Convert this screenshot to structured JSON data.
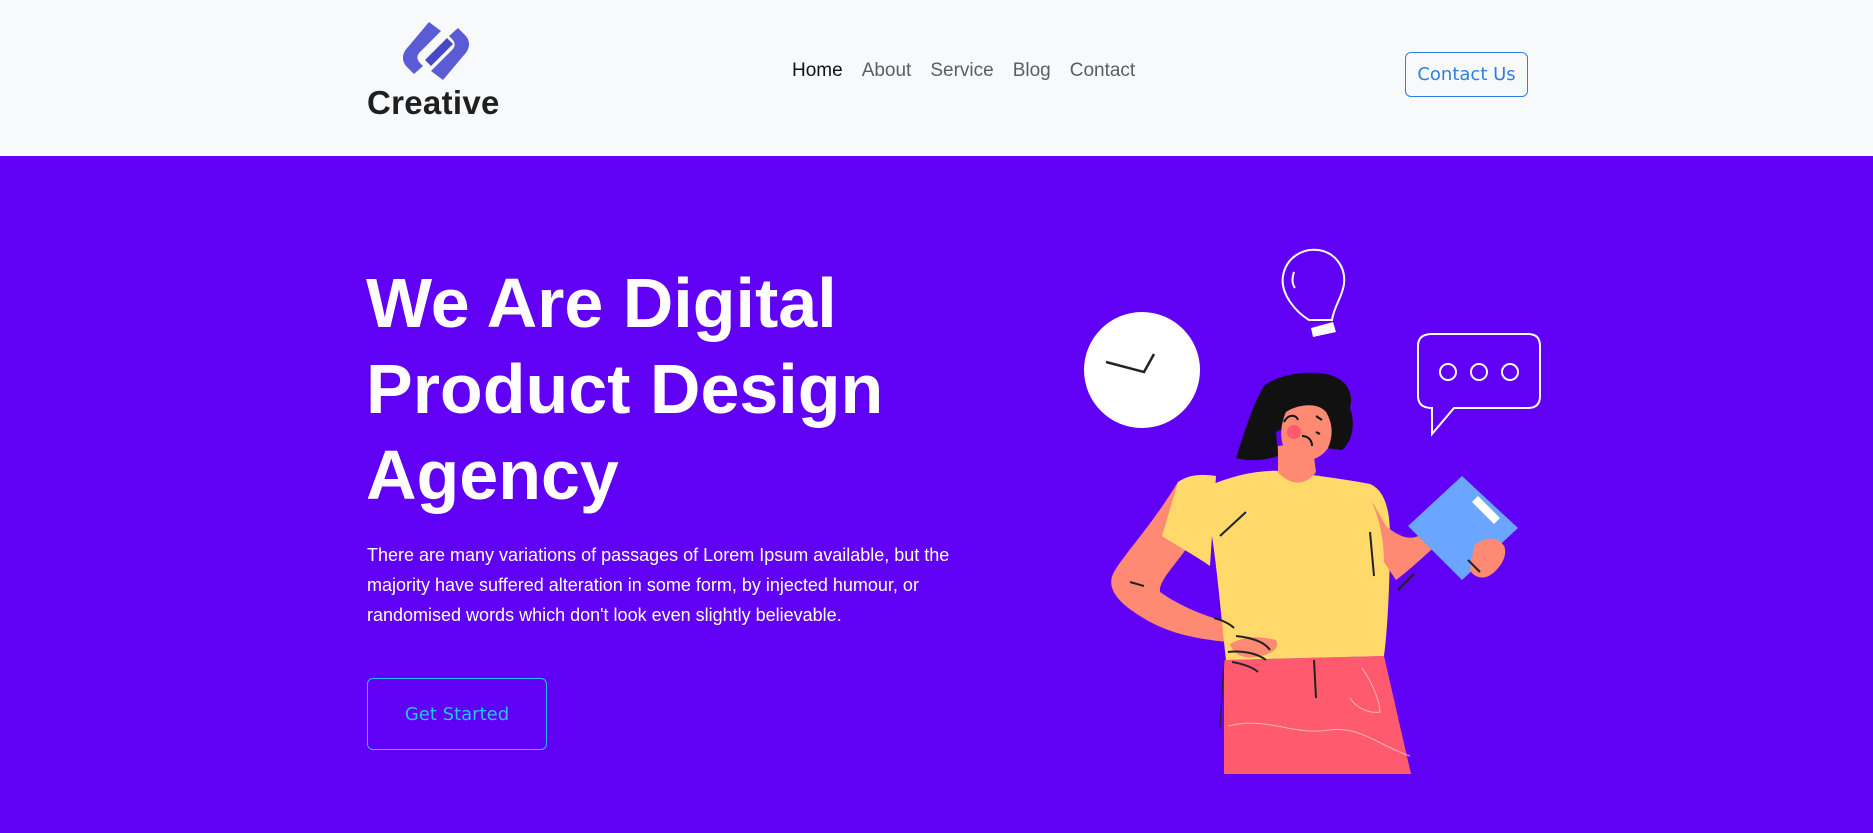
{
  "header": {
    "brand_name": "Creative",
    "logo_icon": "chain-link-logo",
    "nav": {
      "items": [
        {
          "label": "Home",
          "active": true
        },
        {
          "label": "About",
          "active": false
        },
        {
          "label": "Service",
          "active": false
        },
        {
          "label": "Blog",
          "active": false
        },
        {
          "label": "Contact",
          "active": false
        }
      ]
    },
    "contact_button": "Contact Us"
  },
  "hero": {
    "title": "We Are Digital Product Design Agency",
    "description": "There are many variations of passages of Lorem Ipsum available, but the majority have suffered alteration in some form, by injected humour, or randomised words which don't look even slightly believable.",
    "cta_button": "Get Started"
  },
  "colors": {
    "hero_background": "#6000f5",
    "header_background": "#f8f9fb",
    "logo_accent": "#5b5bd6",
    "contact_button_border": "#2f7fe0",
    "cta_button_color": "#22c8f0"
  }
}
